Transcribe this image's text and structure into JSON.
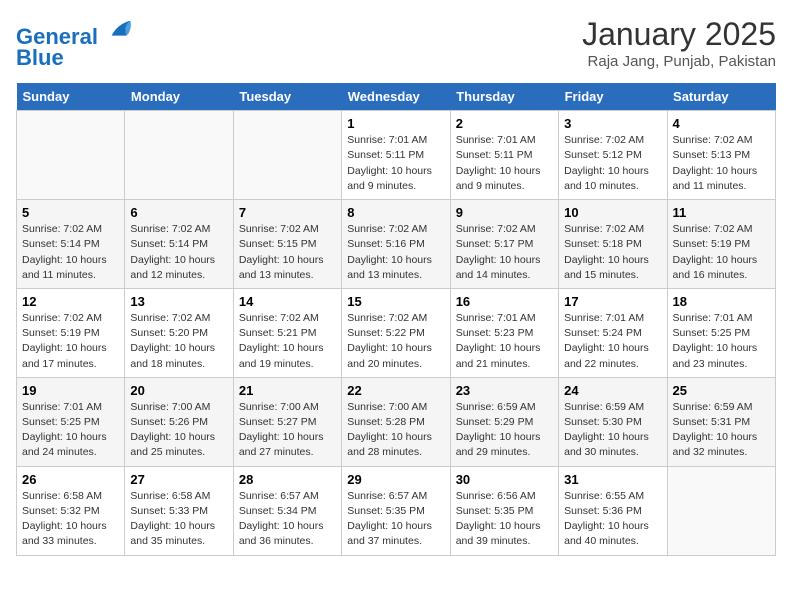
{
  "header": {
    "logo_line1": "General",
    "logo_line2": "Blue",
    "title": "January 2025",
    "subtitle": "Raja Jang, Punjab, Pakistan"
  },
  "weekdays": [
    "Sunday",
    "Monday",
    "Tuesday",
    "Wednesday",
    "Thursday",
    "Friday",
    "Saturday"
  ],
  "weeks": [
    [
      {
        "num": "",
        "info": ""
      },
      {
        "num": "",
        "info": ""
      },
      {
        "num": "",
        "info": ""
      },
      {
        "num": "1",
        "info": "Sunrise: 7:01 AM\nSunset: 5:11 PM\nDaylight: 10 hours\nand 9 minutes."
      },
      {
        "num": "2",
        "info": "Sunrise: 7:01 AM\nSunset: 5:11 PM\nDaylight: 10 hours\nand 9 minutes."
      },
      {
        "num": "3",
        "info": "Sunrise: 7:02 AM\nSunset: 5:12 PM\nDaylight: 10 hours\nand 10 minutes."
      },
      {
        "num": "4",
        "info": "Sunrise: 7:02 AM\nSunset: 5:13 PM\nDaylight: 10 hours\nand 11 minutes."
      }
    ],
    [
      {
        "num": "5",
        "info": "Sunrise: 7:02 AM\nSunset: 5:14 PM\nDaylight: 10 hours\nand 11 minutes."
      },
      {
        "num": "6",
        "info": "Sunrise: 7:02 AM\nSunset: 5:14 PM\nDaylight: 10 hours\nand 12 minutes."
      },
      {
        "num": "7",
        "info": "Sunrise: 7:02 AM\nSunset: 5:15 PM\nDaylight: 10 hours\nand 13 minutes."
      },
      {
        "num": "8",
        "info": "Sunrise: 7:02 AM\nSunset: 5:16 PM\nDaylight: 10 hours\nand 13 minutes."
      },
      {
        "num": "9",
        "info": "Sunrise: 7:02 AM\nSunset: 5:17 PM\nDaylight: 10 hours\nand 14 minutes."
      },
      {
        "num": "10",
        "info": "Sunrise: 7:02 AM\nSunset: 5:18 PM\nDaylight: 10 hours\nand 15 minutes."
      },
      {
        "num": "11",
        "info": "Sunrise: 7:02 AM\nSunset: 5:19 PM\nDaylight: 10 hours\nand 16 minutes."
      }
    ],
    [
      {
        "num": "12",
        "info": "Sunrise: 7:02 AM\nSunset: 5:19 PM\nDaylight: 10 hours\nand 17 minutes."
      },
      {
        "num": "13",
        "info": "Sunrise: 7:02 AM\nSunset: 5:20 PM\nDaylight: 10 hours\nand 18 minutes."
      },
      {
        "num": "14",
        "info": "Sunrise: 7:02 AM\nSunset: 5:21 PM\nDaylight: 10 hours\nand 19 minutes."
      },
      {
        "num": "15",
        "info": "Sunrise: 7:02 AM\nSunset: 5:22 PM\nDaylight: 10 hours\nand 20 minutes."
      },
      {
        "num": "16",
        "info": "Sunrise: 7:01 AM\nSunset: 5:23 PM\nDaylight: 10 hours\nand 21 minutes."
      },
      {
        "num": "17",
        "info": "Sunrise: 7:01 AM\nSunset: 5:24 PM\nDaylight: 10 hours\nand 22 minutes."
      },
      {
        "num": "18",
        "info": "Sunrise: 7:01 AM\nSunset: 5:25 PM\nDaylight: 10 hours\nand 23 minutes."
      }
    ],
    [
      {
        "num": "19",
        "info": "Sunrise: 7:01 AM\nSunset: 5:25 PM\nDaylight: 10 hours\nand 24 minutes."
      },
      {
        "num": "20",
        "info": "Sunrise: 7:00 AM\nSunset: 5:26 PM\nDaylight: 10 hours\nand 25 minutes."
      },
      {
        "num": "21",
        "info": "Sunrise: 7:00 AM\nSunset: 5:27 PM\nDaylight: 10 hours\nand 27 minutes."
      },
      {
        "num": "22",
        "info": "Sunrise: 7:00 AM\nSunset: 5:28 PM\nDaylight: 10 hours\nand 28 minutes."
      },
      {
        "num": "23",
        "info": "Sunrise: 6:59 AM\nSunset: 5:29 PM\nDaylight: 10 hours\nand 29 minutes."
      },
      {
        "num": "24",
        "info": "Sunrise: 6:59 AM\nSunset: 5:30 PM\nDaylight: 10 hours\nand 30 minutes."
      },
      {
        "num": "25",
        "info": "Sunrise: 6:59 AM\nSunset: 5:31 PM\nDaylight: 10 hours\nand 32 minutes."
      }
    ],
    [
      {
        "num": "26",
        "info": "Sunrise: 6:58 AM\nSunset: 5:32 PM\nDaylight: 10 hours\nand 33 minutes."
      },
      {
        "num": "27",
        "info": "Sunrise: 6:58 AM\nSunset: 5:33 PM\nDaylight: 10 hours\nand 35 minutes."
      },
      {
        "num": "28",
        "info": "Sunrise: 6:57 AM\nSunset: 5:34 PM\nDaylight: 10 hours\nand 36 minutes."
      },
      {
        "num": "29",
        "info": "Sunrise: 6:57 AM\nSunset: 5:35 PM\nDaylight: 10 hours\nand 37 minutes."
      },
      {
        "num": "30",
        "info": "Sunrise: 6:56 AM\nSunset: 5:35 PM\nDaylight: 10 hours\nand 39 minutes."
      },
      {
        "num": "31",
        "info": "Sunrise: 6:55 AM\nSunset: 5:36 PM\nDaylight: 10 hours\nand 40 minutes."
      },
      {
        "num": "",
        "info": ""
      }
    ]
  ]
}
